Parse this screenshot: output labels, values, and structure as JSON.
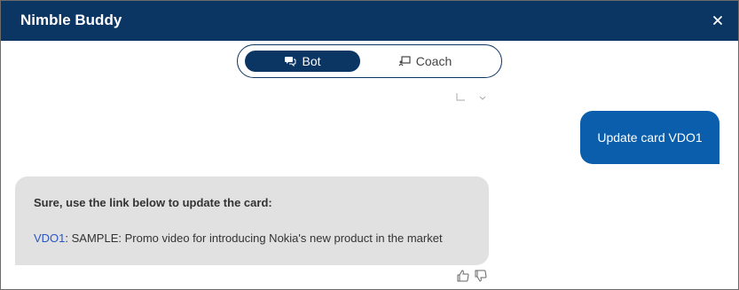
{
  "header": {
    "title": "Nimble Buddy",
    "close_icon": "close-icon"
  },
  "toggle": {
    "bot": {
      "label": "Bot",
      "icon": "chat-bubbles-icon",
      "selected": true
    },
    "coach": {
      "label": "Coach",
      "icon": "coach-board-icon",
      "selected": false
    }
  },
  "messages": {
    "user": {
      "text": "Update card VDO1"
    },
    "bot": {
      "intro": "Sure, use the link below to update the card:",
      "link_text": "VDO1",
      "link_suffix": ": SAMPLE: Promo video for introducing Nokia's new product in the market"
    }
  },
  "colors": {
    "header": "#0b3563",
    "user_bubble": "#0b5eab",
    "bot_bubble": "#e1e1e1",
    "link": "#2a55c8"
  }
}
